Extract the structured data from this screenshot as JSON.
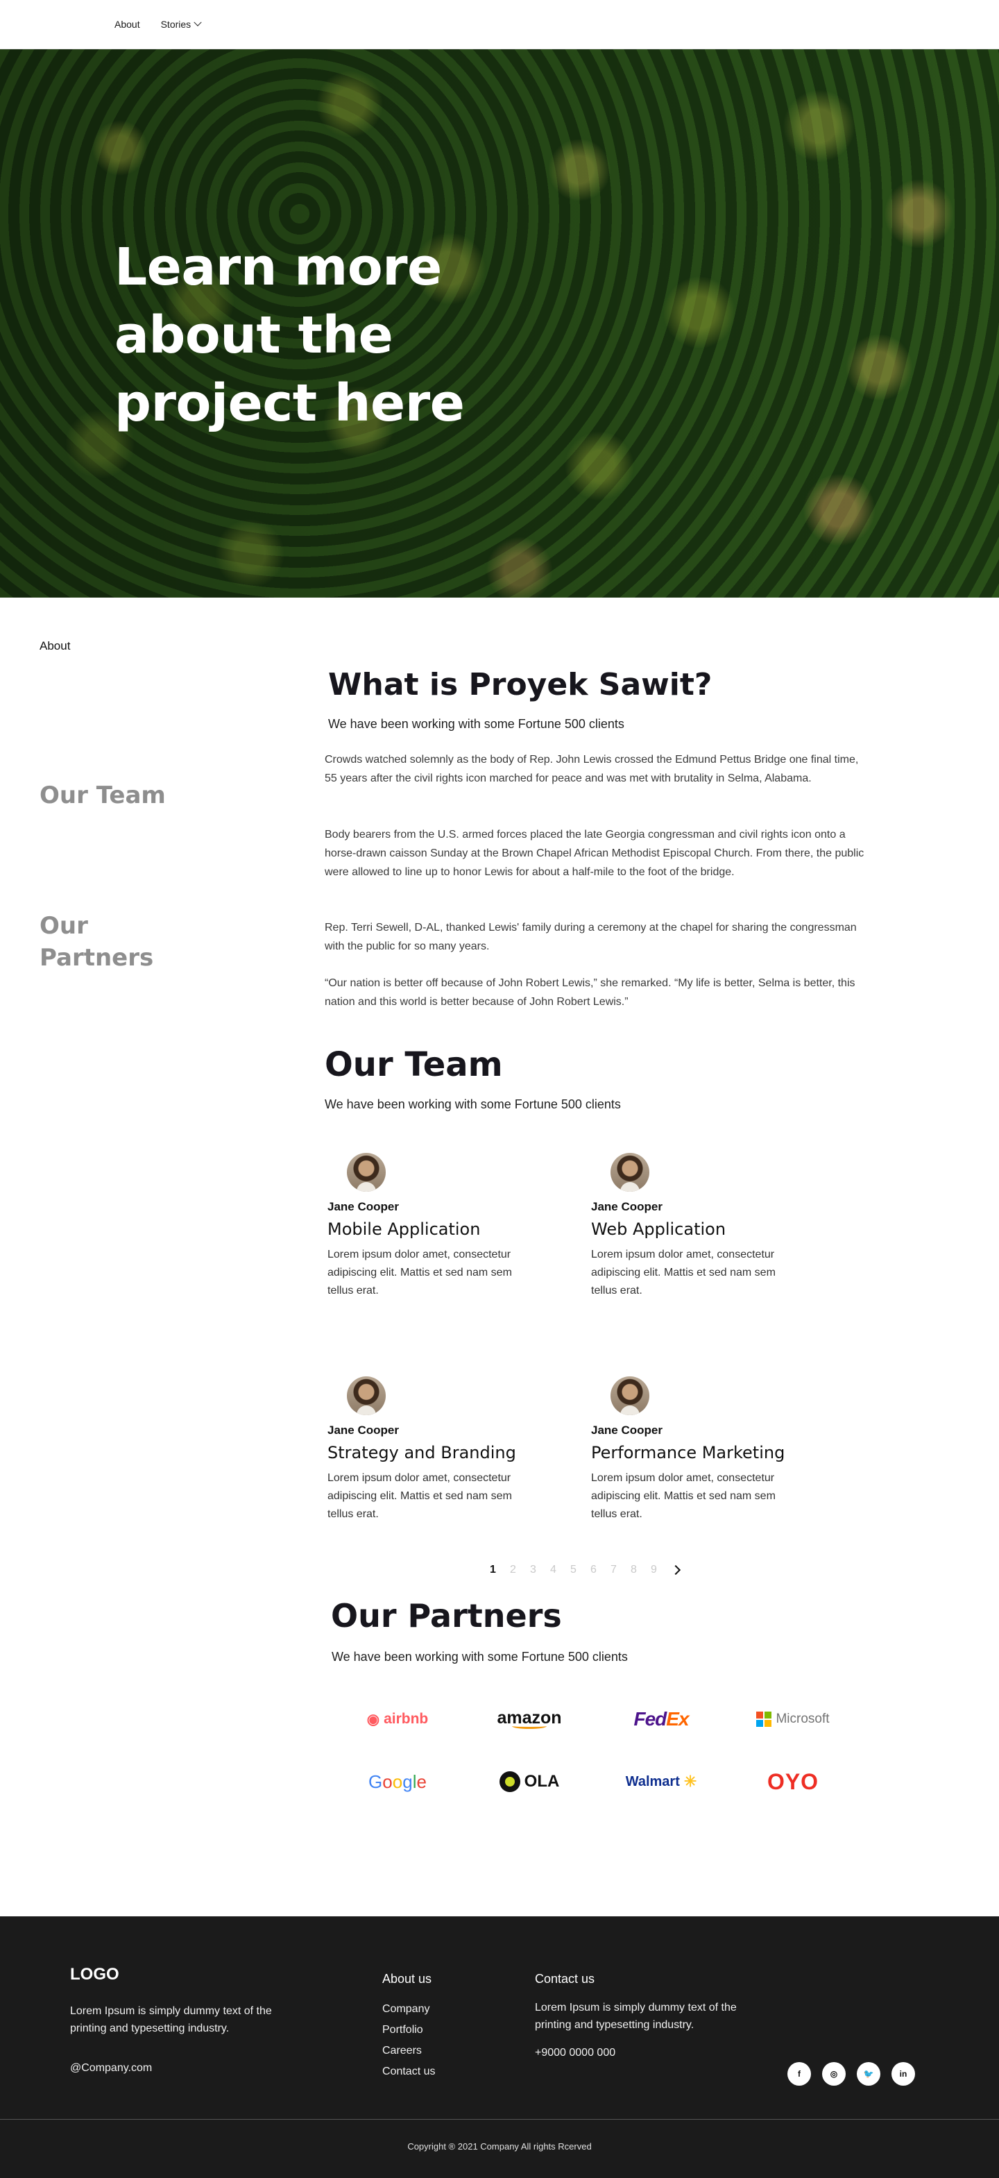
{
  "nav": {
    "items": [
      {
        "label": "About"
      },
      {
        "label": "Stories"
      }
    ]
  },
  "hero": {
    "title": "Learn more about the project here"
  },
  "sidebar": {
    "about": "About",
    "team": "Our Team",
    "partners": "Our Partners"
  },
  "what": {
    "title": "What is Proyek Sawit?",
    "subtitle": "We have been working with some Fortune 500 clients",
    "paragraphs": [
      "Crowds watched solemnly as the body of Rep. John Lewis crossed the Edmund Pettus Bridge one final time, 55 years after the civil rights icon marched for peace and was met with brutality in Selma, Alabama.",
      "Body bearers from the U.S. armed forces placed the late Georgia congressman and civil rights icon onto a horse-drawn caisson Sunday at the Brown Chapel African Methodist Episcopal Church. From there, the public were allowed to line up to honor Lewis for about a half-mile to the foot of the bridge.",
      "Rep. Terri Sewell, D-AL, thanked Lewis' family during a ceremony at the chapel for sharing the congressman with the public for so many years.",
      "“Our nation is better off because of John Robert Lewis,” she remarked. “My life is better, Selma is better, this nation and this world is better because of John Robert Lewis.”"
    ]
  },
  "team": {
    "title": "Our Team",
    "subtitle": "We have been working with some Fortune 500 clients",
    "members": [
      {
        "name": "Jane Cooper",
        "role": "Mobile Application",
        "desc": "Lorem ipsum dolor amet, consectetur adipiscing elit. Mattis et sed nam sem tellus erat."
      },
      {
        "name": "Jane Cooper",
        "role": "Web Application",
        "desc": "Lorem ipsum dolor amet, consectetur adipiscing elit. Mattis et sed nam sem tellus erat."
      },
      {
        "name": "Jane Cooper",
        "role": "Strategy and Branding",
        "desc": "Lorem ipsum dolor amet, consectetur adipiscing elit. Mattis et sed nam sem tellus erat."
      },
      {
        "name": "Jane Cooper",
        "role": "Performance Marketing",
        "desc": "Lorem ipsum dolor amet, consectetur adipiscing elit. Mattis et sed nam sem tellus erat."
      }
    ]
  },
  "pagination": {
    "pages": [
      "1",
      "2",
      "3",
      "4",
      "5",
      "6",
      "7",
      "8",
      "9"
    ],
    "current": "1"
  },
  "partners": {
    "title": "Our Partners",
    "subtitle": "We have been working with some Fortune 500 clients",
    "logos": {
      "airbnb": "airbnb",
      "amazon": "amazon",
      "fedex_fe": "Fed",
      "fedex_ex": "Ex",
      "microsoft": "Microsoft",
      "google": [
        "G",
        "o",
        "o",
        "g",
        "l",
        "e"
      ],
      "ola": "OLA",
      "walmart": "Walmart",
      "oyo": "OYO"
    }
  },
  "footer": {
    "logo": "LOGO",
    "desc": "Lorem Ipsum is simply dummy text of the printing and typesetting industry.",
    "email": "@Company.com",
    "about_title": "About us",
    "about_links": [
      "Company",
      "Portfolio",
      "Careers",
      "Contact us"
    ],
    "contact_title": "Contact us",
    "contact_desc": "Lorem Ipsum is simply dummy text of the printing and typesetting industry.",
    "phone": "+9000 0000 000",
    "socials": [
      {
        "icon": "facebook-icon",
        "glyph": "f"
      },
      {
        "icon": "instagram-icon",
        "glyph": "◎"
      },
      {
        "icon": "twitter-icon",
        "glyph": "🐦"
      },
      {
        "icon": "linkedin-icon",
        "glyph": "in"
      }
    ],
    "copyright": "Copyright ® 2021 Company All rights Rcerved"
  },
  "colors": {
    "accent_airbnb": "#ff5a5f",
    "fedex_purple": "#4d148c",
    "fedex_orange": "#ff6600",
    "oyo_red": "#ee2e24",
    "footer_bg": "#1b1b1b"
  }
}
